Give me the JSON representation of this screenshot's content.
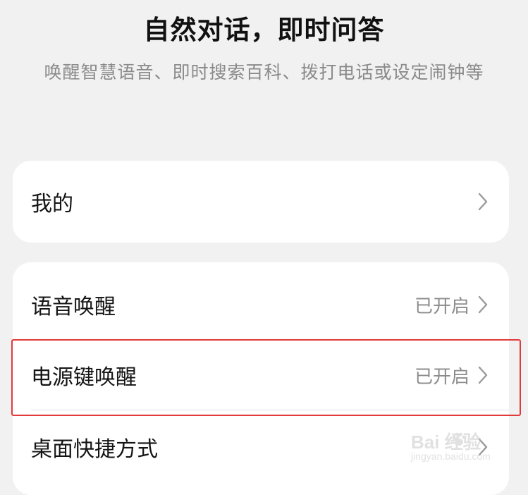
{
  "header": {
    "title": "自然对话，即时问答",
    "subtitle": "唤醒智慧语音、即时搜索百科、拨打电话或设定闹钟等"
  },
  "card_mine": {
    "label": "我的",
    "icon": "chevron-right-icon"
  },
  "card_wake": {
    "items": [
      {
        "label": "语音唤醒",
        "value": "已开启",
        "icon": "chevron-right-icon"
      },
      {
        "label": "电源键唤醒",
        "value": "已开启",
        "icon": "chevron-right-icon"
      },
      {
        "label": "桌面快捷方式",
        "icon": "chevron-right-icon"
      }
    ]
  },
  "highlight": {
    "target": "电源键唤醒",
    "color": "#e23a3a"
  },
  "watermark": {
    "logo_text": "Bai 经验",
    "sub_text": "jingyan.baidu.com"
  },
  "colors": {
    "background": "#f1f1f1",
    "card": "#ffffff",
    "secondary_text": "#8c8c8c",
    "highlight": "#e23a3a"
  }
}
